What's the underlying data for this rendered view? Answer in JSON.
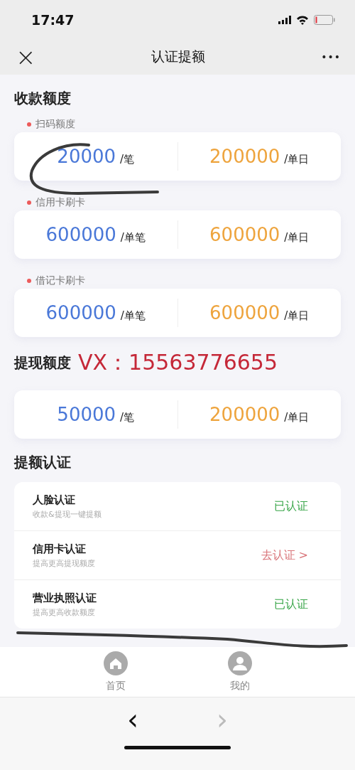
{
  "status_bar": {
    "time": "17:47"
  },
  "nav": {
    "close": "×",
    "title": "认证提额",
    "more": "•••"
  },
  "collection": {
    "title": "收款额度",
    "groups": [
      {
        "label": "扫码额度",
        "per_txn": "20000",
        "per_txn_unit": "/笔",
        "per_day": "200000",
        "per_day_unit": "/单日"
      },
      {
        "label": "信用卡刷卡",
        "per_txn": "600000",
        "per_txn_unit": "/单笔",
        "per_day": "600000",
        "per_day_unit": "/单日"
      },
      {
        "label": "借记卡刷卡",
        "per_txn": "600000",
        "per_txn_unit": "/单笔",
        "per_day": "600000",
        "per_day_unit": "/单日"
      }
    ]
  },
  "withdrawal": {
    "title": "提现额度",
    "overlay_note": "VX：15563776655",
    "per_txn": "50000",
    "per_txn_unit": "/笔",
    "per_day": "200000",
    "per_day_unit": "/单日"
  },
  "verification": {
    "title": "提额认证",
    "items": [
      {
        "name": "人脸认证",
        "hint": "收款&提现一键提额",
        "verified": true,
        "status": "已认证"
      },
      {
        "name": "信用卡认证",
        "hint": "提高更高提现额度",
        "verified": false,
        "status": "去认证 >"
      },
      {
        "name": "营业执照认证",
        "hint": "提高更高收款额度",
        "verified": true,
        "status": "已认证"
      }
    ]
  },
  "tab_bar": {
    "items": [
      {
        "kind": "home",
        "label": "首页"
      },
      {
        "kind": "profile",
        "label": "我的"
      }
    ]
  },
  "browser_toolbar": {
    "back": "‹",
    "forward": "›"
  }
}
